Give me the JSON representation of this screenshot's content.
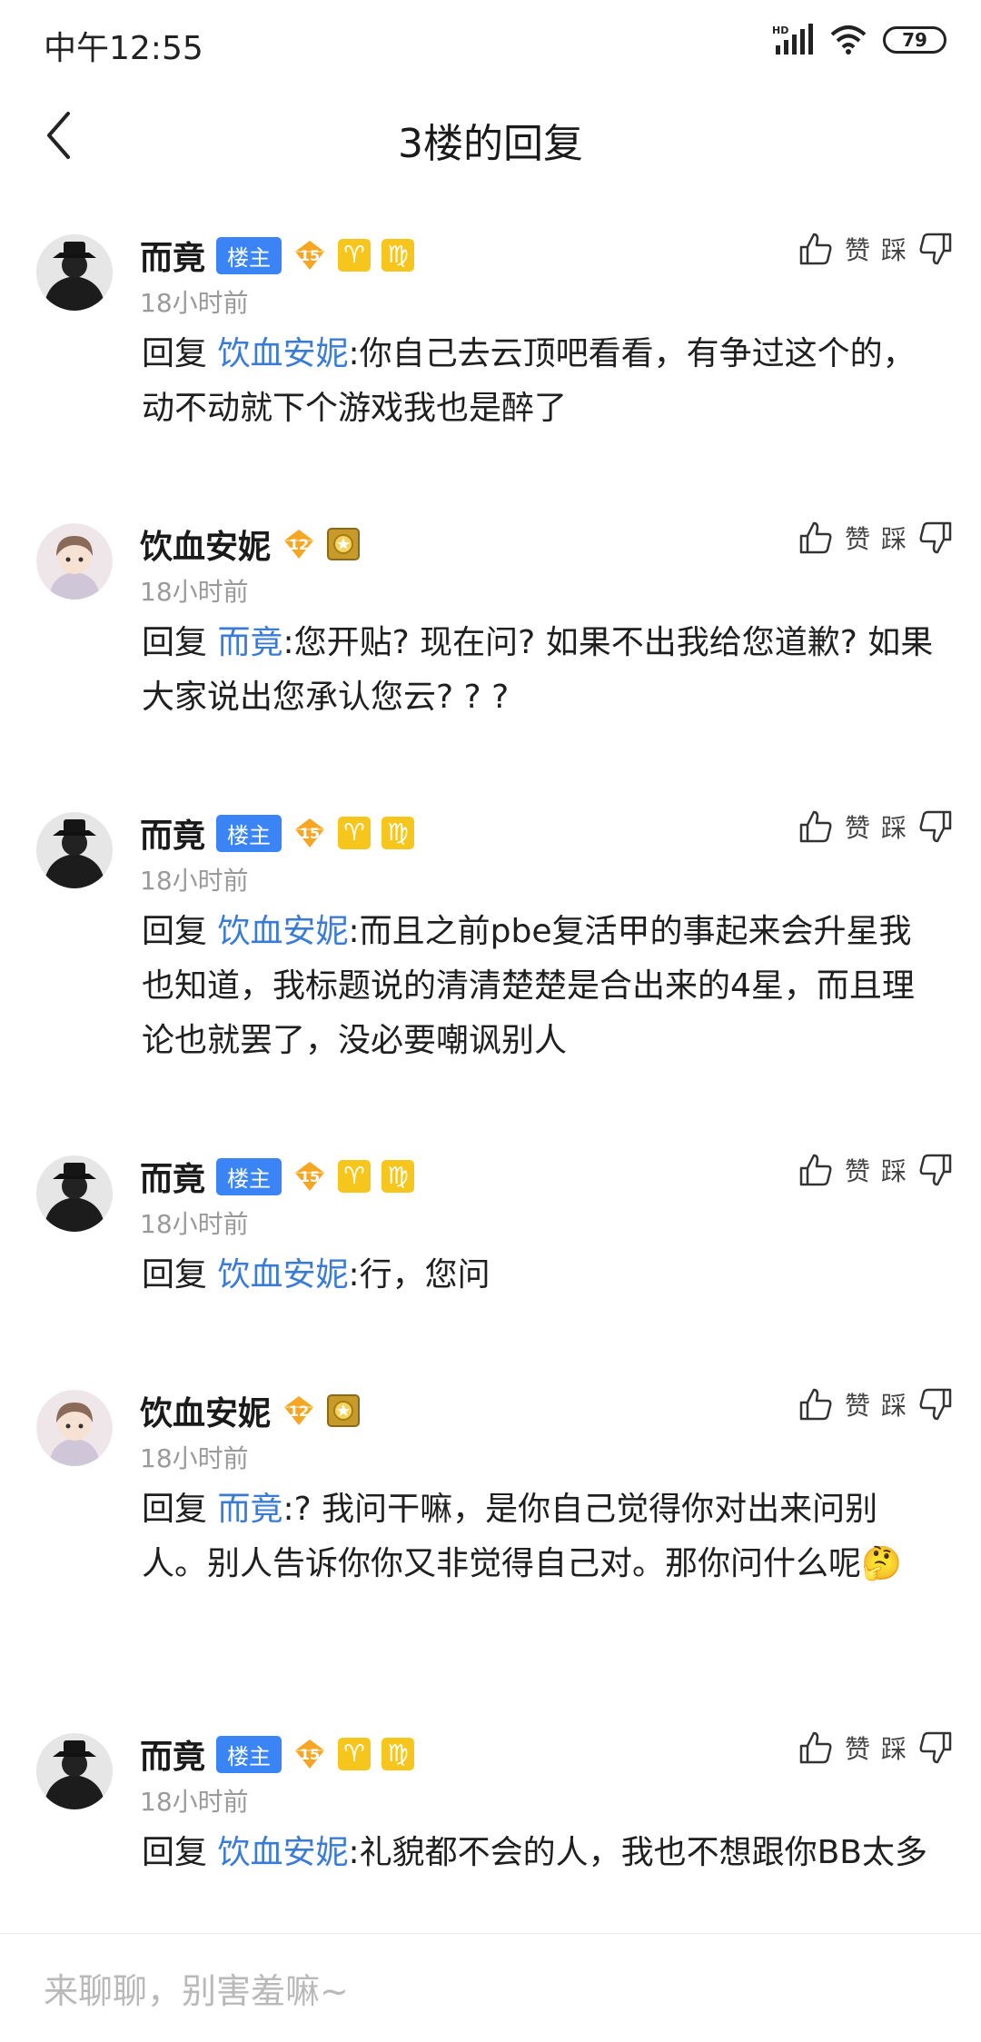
{
  "status_bar": {
    "time": "中午12:55",
    "signal_label": "HD",
    "battery": "79"
  },
  "nav": {
    "title": "3楼的回复"
  },
  "reply_prefix": "回复",
  "actions": {
    "like": "赞",
    "dislike": "踩"
  },
  "comments": [
    {
      "username": "而竟",
      "is_op": true,
      "op_label": "楼主",
      "level": "15",
      "time": "18小时前",
      "target": "饮血安妮",
      "text": ":你自己去云顶吧看看，有争过这个的，动不动就下个游戏我也是醉了"
    },
    {
      "username": "饮血安妮",
      "is_op": false,
      "level": "12",
      "time": "18小时前",
      "target": "而竟",
      "text": ":您开贴? 现在问? 如果不出我给您道歉? 如果大家说出您承认您云? ? ?"
    },
    {
      "username": "而竟",
      "is_op": true,
      "op_label": "楼主",
      "level": "15",
      "time": "18小时前",
      "target": "饮血安妮",
      "text": ":而且之前pbe复活甲的事起来会升星我也知道，我标题说的清清楚楚是合出来的4星，而且理论也就罢了，没必要嘲讽别人"
    },
    {
      "username": "而竟",
      "is_op": true,
      "op_label": "楼主",
      "level": "15",
      "time": "18小时前",
      "target": "饮血安妮",
      "text": ":行，您问"
    },
    {
      "username": "饮血安妮",
      "is_op": false,
      "level": "12",
      "time": "18小时前",
      "target": "而竟",
      "text": ":? 我问干嘛，是你自己觉得你对出来问别人。别人告诉你你又非觉得自己对。那你问什么呢🤔"
    },
    {
      "username": "而竟",
      "is_op": true,
      "op_label": "楼主",
      "level": "15",
      "time": "18小时前",
      "target": "饮血安妮",
      "text": ":礼貌都不会的人，我也不想跟你BB太多"
    }
  ],
  "composer": {
    "placeholder": "来聊聊，别害羞嘛~"
  },
  "colors": {
    "accent": "#3a7bd5",
    "op_tag": "#3a84f6",
    "level_badge": "#f5a623",
    "muted": "#9a9a9a"
  }
}
